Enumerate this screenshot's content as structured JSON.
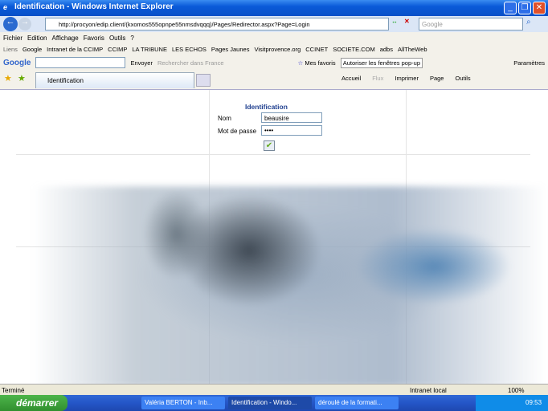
{
  "window": {
    "title": "Identification - Windows Internet Explorer"
  },
  "address": {
    "url": "http://procyon/edip.client/(kxomos555opnpe55nmsdvqqq)/Pages/Redirector.aspx?Page=Login",
    "search_placeholder": "Google"
  },
  "menu": [
    "Fichier",
    "Edition",
    "Affichage",
    "Favoris",
    "Outils",
    "?"
  ],
  "links": {
    "label": "Liens",
    "items": [
      "Google",
      "Intranet de la CCIMP",
      "CCIMP",
      "LA TRIBUNE",
      "LES ECHOS",
      "Pages Jaunes",
      "Visitprovence.org",
      "CCINET",
      "SOCIETE.COM",
      "adbs",
      "AllTheWeb"
    ]
  },
  "google_toolbar": {
    "logo": "Google",
    "send": "Envoyer",
    "search_france": "Rechercher dans France",
    "favorites": "Mes favoris",
    "popups": "Autoriser les fenêtres pop-up",
    "settings": "Paramètres"
  },
  "tabs": {
    "active": "Identification",
    "commands": [
      "Accueil",
      "Flux",
      "Imprimer",
      "Page",
      "Outils"
    ]
  },
  "form": {
    "title": "Identification",
    "name_label": "Nom",
    "name_value": "beausire",
    "password_label": "Mot de passe",
    "password_value": "••••"
  },
  "status": {
    "text": "Terminé",
    "zone": "Intranet local",
    "zoom": "100%"
  },
  "taskbar": {
    "start": "démarrer",
    "tasks": [
      "Valéria BERTON - Inb...",
      "Identification - Windo...",
      "déroulé de la formati..."
    ],
    "clock": "09:53"
  }
}
